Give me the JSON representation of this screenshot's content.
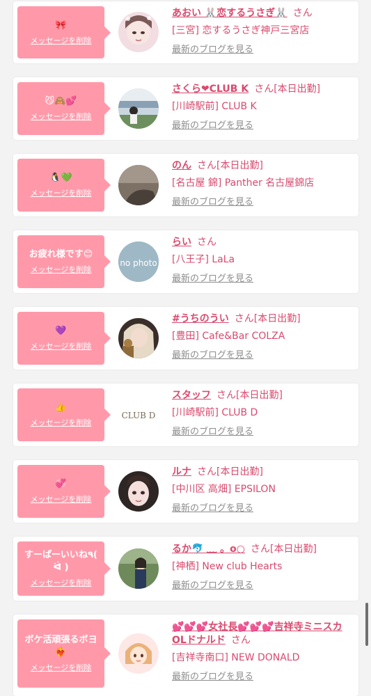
{
  "common": {
    "san": "さん",
    "delete_label": "メッセージを削除",
    "blog_link": "最新のブログを見る"
  },
  "cards": [
    {
      "message": "🎀",
      "name": "あおい 🐰恋するうさぎ🐰",
      "status": "",
      "shop": "[三宮] 恋するうさぎ神戸三宮店",
      "photo": "photo"
    },
    {
      "message": "😼🙈💕",
      "name": "さくら❤CLUB K",
      "status": "[本日出勤]",
      "shop": "[川崎駅前] CLUB K",
      "photo": "photo"
    },
    {
      "message": "🐧💚",
      "name": "のん",
      "status": "[本日出勤]",
      "shop": "[名古屋 錦] Panther 名古屋錦店",
      "photo": "photo"
    },
    {
      "message": "お疲れ様です😊",
      "name": "らい",
      "status": "",
      "shop": "[八王子] LaLa",
      "photo": "no photo"
    },
    {
      "message": "💜",
      "name": "#うちのうい",
      "status": "[本日出勤]",
      "shop": "[豊田] Cafe&Bar COLZA",
      "photo": "photo"
    },
    {
      "message": "👍",
      "name": "スタッフ",
      "status": "[本日出勤]",
      "shop": "[川崎駅前] CLUB D",
      "photo": "CLUB D"
    },
    {
      "message": "💞",
      "name": "ルナ",
      "status": "[本日出勤]",
      "shop": "[中川区 高畑] EPSILON",
      "photo": "photo"
    },
    {
      "message": "すーぱーいいね٩( ᐛ )",
      "name": "るか🐬 ﹏ 。o○",
      "status": "[本日出勤]",
      "shop": "[神栖] New club Hearts",
      "photo": "photo"
    },
    {
      "message": "ボケ活頑張るボヨ❤️‍🔥",
      "name": "💕💕💕女社長💕💕💕吉祥寺ミニスカOLドナルド",
      "status": "",
      "shop": "[吉祥寺南口] NEW DONALD",
      "photo": "photo"
    }
  ]
}
